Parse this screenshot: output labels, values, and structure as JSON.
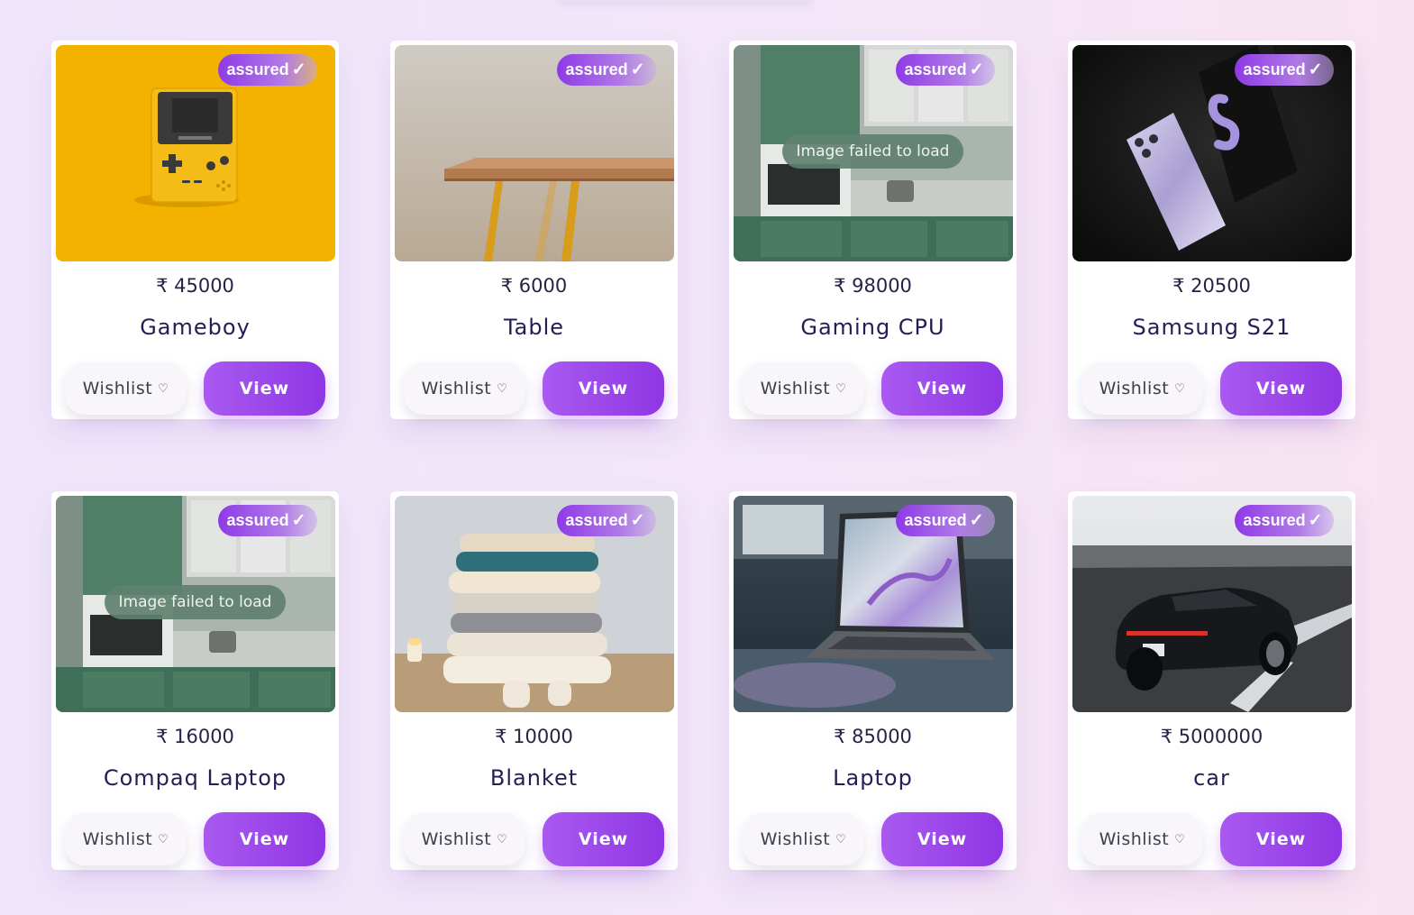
{
  "products": [
    {
      "badge": "assured",
      "price": "₹ 45000",
      "name": "Gameboy",
      "image": "gameboy-photo",
      "image_error": "",
      "wishlist": "Wishlist",
      "view": "View"
    },
    {
      "badge": "assured",
      "price": "₹ 6000",
      "name": "Table",
      "image": "table-photo",
      "image_error": "",
      "wishlist": "Wishlist",
      "view": "View"
    },
    {
      "badge": "assured",
      "price": "₹ 98000",
      "name": "Gaming CPU",
      "image": "kitchen-placeholder",
      "image_error": "Image failed to load",
      "wishlist": "Wishlist",
      "view": "View"
    },
    {
      "badge": "assured",
      "price": "₹ 20500",
      "name": "Samsung S21",
      "image": "samsung-s21-photo",
      "image_error": "",
      "wishlist": "Wishlist",
      "view": "View"
    },
    {
      "badge": "assured",
      "price": "₹ 16000",
      "name": "Compaq Laptop",
      "image": "kitchen-placeholder",
      "image_error": "Image failed to load",
      "wishlist": "Wishlist",
      "view": "View"
    },
    {
      "badge": "assured",
      "price": "₹ 10000",
      "name": "Blanket",
      "image": "blanket-photo",
      "image_error": "",
      "wishlist": "Wishlist",
      "view": "View"
    },
    {
      "badge": "assured",
      "price": "₹ 85000",
      "name": "Laptop",
      "image": "laptop-photo",
      "image_error": "",
      "wishlist": "Wishlist",
      "view": "View"
    },
    {
      "badge": "assured",
      "price": "₹ 5000000",
      "name": "car",
      "image": "car-photo",
      "image_error": "",
      "wishlist": "Wishlist",
      "view": "View"
    }
  ],
  "icons": {
    "badge_check": "check-icon",
    "wishlist": "heart-outline-icon"
  },
  "colors": {
    "accent": "#9b45ea",
    "text_dark": "#2a1b55",
    "gameboy_bg": "#f4b200"
  }
}
